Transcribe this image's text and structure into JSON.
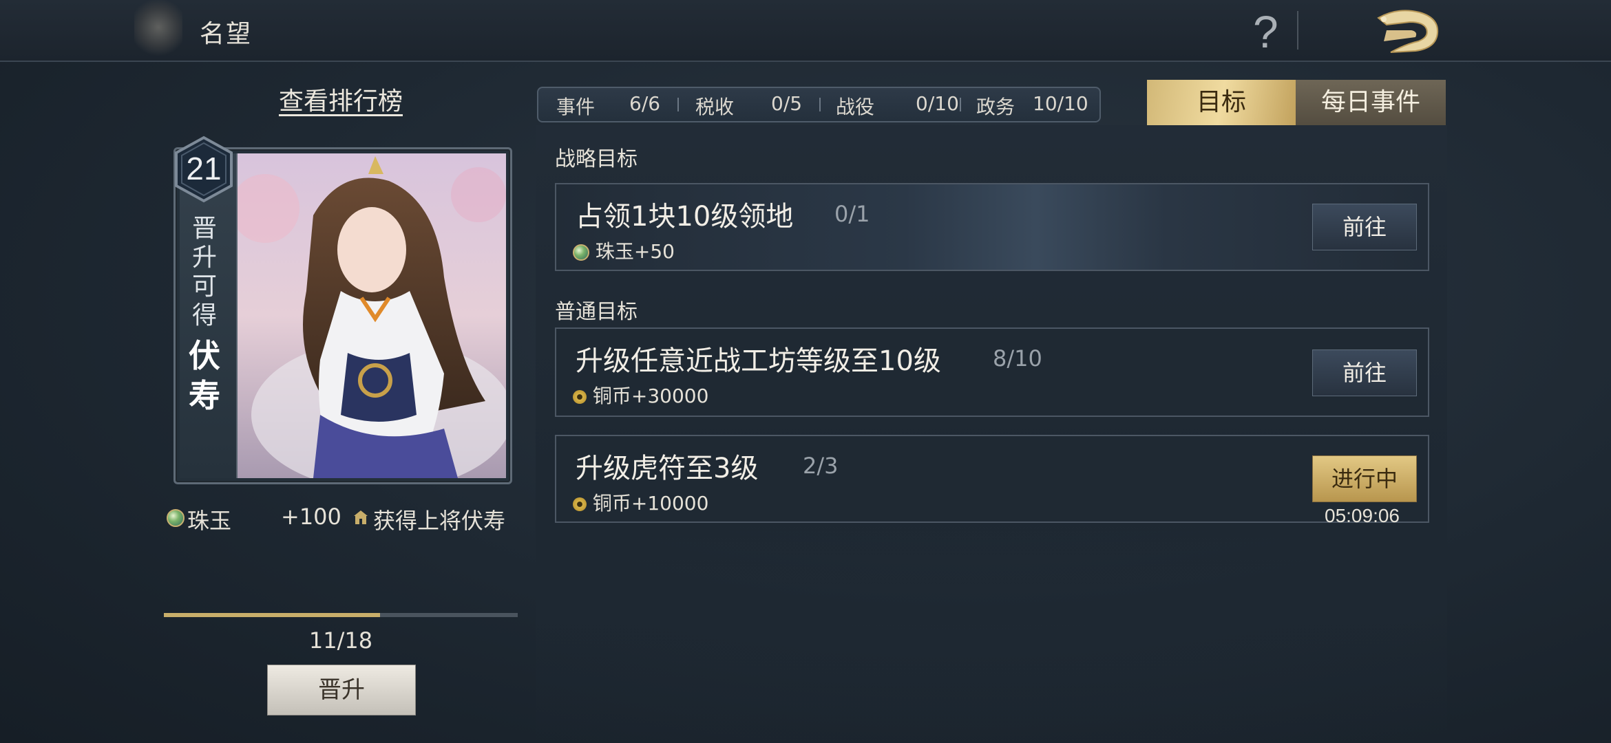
{
  "topbar": {
    "title": "名望",
    "help_glyph": "?",
    "back_icon": "dragon-back-icon"
  },
  "left": {
    "leaderboard_link": "查看排行榜",
    "level": "21",
    "promo_chars": [
      "晋",
      "升",
      "可",
      "得"
    ],
    "promo_name_chars": [
      "伏",
      "寿"
    ],
    "reward_name": "珠玉",
    "reward_amount": "+100",
    "reward_general": "获得上将伏寿",
    "progress_text": "11/18",
    "progress_value": 11,
    "progress_max": 18,
    "promote_button": "晋升"
  },
  "stats": [
    {
      "label": "事件",
      "value": "6/6"
    },
    {
      "label": "税收",
      "value": "0/5"
    },
    {
      "label": "战役",
      "value": "0/10"
    },
    {
      "label": "政务",
      "value": "10/10"
    }
  ],
  "tabs": {
    "target": "目标",
    "daily": "每日事件"
  },
  "sections": {
    "strategic": "战略目标",
    "normal": "普通目标"
  },
  "goals": [
    {
      "title": "占领1块10级领地",
      "progress": "0/1",
      "reward_icon": "gem-icon",
      "reward": "珠玉+50",
      "button": "前往"
    },
    {
      "title": "升级任意近战工坊等级至10级",
      "progress": "8/10",
      "reward_icon": "coin-icon",
      "reward": "铜币+30000",
      "button": "前往"
    },
    {
      "title": "升级虎符至3级",
      "progress": "2/3",
      "reward_icon": "coin-icon",
      "reward": "铜币+10000",
      "button": "进行中",
      "timer": "05:09:06"
    }
  ],
  "colors": {
    "gold_accent": "#d2b877",
    "panel_bg": "#1f2933",
    "progress_fill": "#c8ae6a"
  }
}
